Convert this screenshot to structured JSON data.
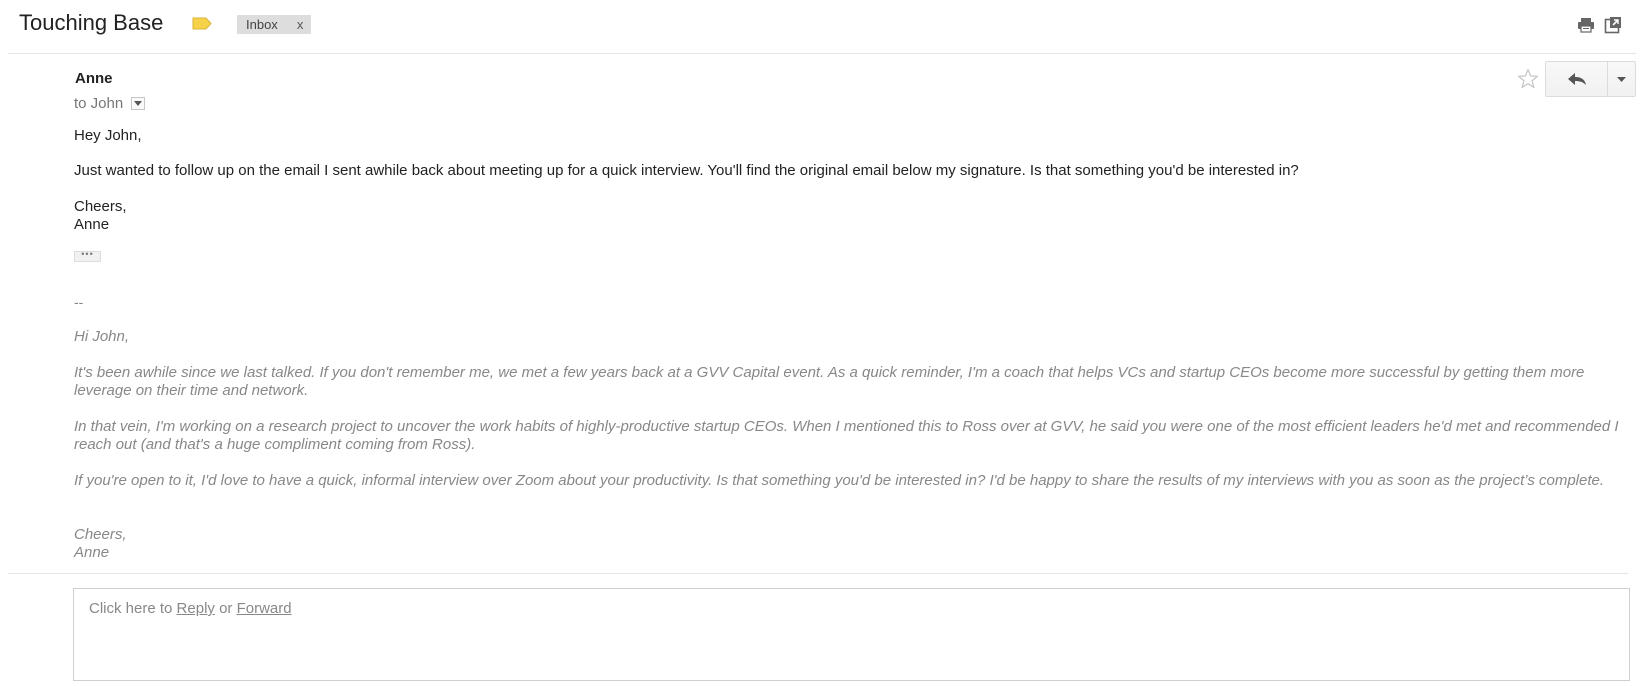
{
  "header": {
    "subject": "Touching Base",
    "label_chip": "Inbox",
    "label_chip_close": "x",
    "icons": {
      "label": "label-tag-icon",
      "print": "print-icon",
      "new_window": "new-window-icon"
    },
    "label_color": "#f5d248"
  },
  "message": {
    "sender": "Anne",
    "to_prefix": "to John",
    "greeting": "Hey John,",
    "paragraph": "Just wanted to follow up on the email I sent awhile back about meeting up for a quick interview. You'll find the original email below my signature. Is that something you'd be interested in?",
    "closing": "Cheers,",
    "signature": "Anne",
    "ellipsis": "•••",
    "actions": {
      "star": "star-icon",
      "reply": "reply-icon",
      "more": "dropdown-arrow-icon"
    }
  },
  "quoted": {
    "separator": "--",
    "greeting": "Hi John,",
    "paragraphs": [
      "It's been awhile since we last talked. If you don't remember me, we met a few years back at a GVV Capital event. As a quick reminder, I'm a coach that helps VCs and startup CEOs become more successful by getting them more leverage on their time and network.",
      "In that vein, I'm working on a research project to uncover the work habits of highly-productive startup CEOs. When I mentioned this to Ross over at GVV, he said you were one of the most efficient leaders he'd met and recommended I reach out (and that's a huge compliment coming from Ross).",
      "If you're open to it, I'd love to have a quick, informal interview over Zoom about your productivity. Is that something you'd be interested in? I'd be happy to share the results of my interviews with you as soon as the project’s complete."
    ],
    "closing": "Cheers,",
    "signature": "Anne"
  },
  "reply_box": {
    "prefix": "Click here to",
    "reply_link": "Reply",
    "or": "or",
    "forward_link": "Forward"
  }
}
